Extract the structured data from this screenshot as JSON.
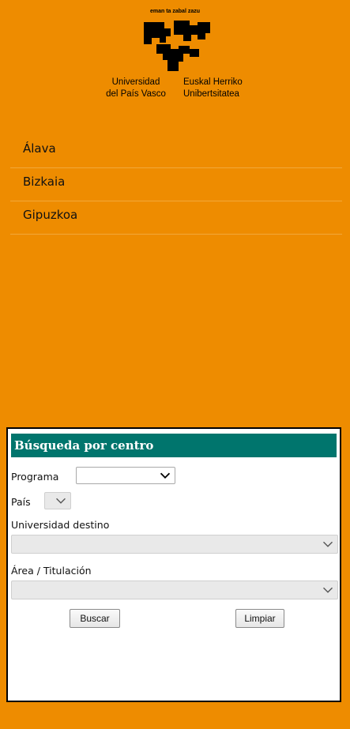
{
  "header": {
    "motto": "eman ta zabal zazu",
    "university_es": [
      "Universidad",
      "del País Vasco"
    ],
    "university_eu": [
      "Euskal Herriko",
      "Unibertsitatea"
    ]
  },
  "nav": {
    "items": [
      {
        "label": "Álava"
      },
      {
        "label": "Bizkaia"
      },
      {
        "label": "Gipuzkoa"
      }
    ]
  },
  "search": {
    "title": "Búsqueda por centro",
    "programa_label": "Programa",
    "programa_value": "",
    "pais_label": "País",
    "pais_value": "",
    "universidad_label": "Universidad destino",
    "universidad_value": "",
    "area_label": "Área / Titulación",
    "area_value": "",
    "buscar_label": "Buscar",
    "limpiar_label": "Limpiar"
  },
  "colors": {
    "background": "#ee8c00",
    "panel_header": "#00756d"
  },
  "icons": [
    "university-logo-icon",
    "chevron-down-icon"
  ]
}
